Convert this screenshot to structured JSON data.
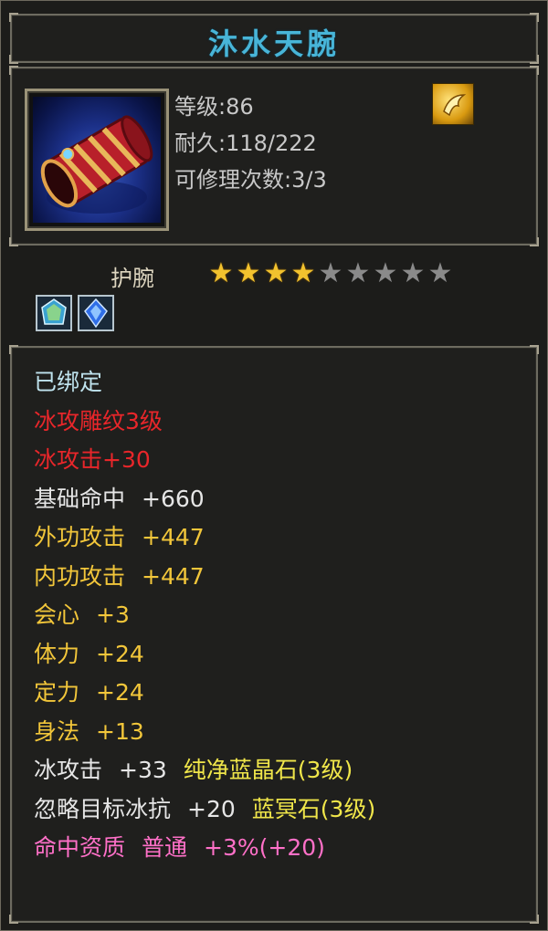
{
  "item_name": "沐水天腕",
  "level_label": "等级:86",
  "durability_label": "耐久:118/222",
  "repair_label": "可修理次数:3/3",
  "slot_type": "护腕",
  "stars": {
    "filled": 4,
    "total": 9
  },
  "gems": [
    "green-gem-icon",
    "blue-gem-icon"
  ],
  "attributes": [
    {
      "parts": [
        "已绑定"
      ],
      "color": "#bfe3ee"
    },
    {
      "parts": [
        "冰攻雕纹3级"
      ],
      "color": "#e8262a"
    },
    {
      "parts": [
        "冰攻击+30"
      ],
      "color": "#e8262a"
    },
    {
      "parts": [
        "基础命中",
        "+660"
      ],
      "color": "#e6e6e6"
    },
    {
      "parts": [
        "外功攻击",
        "+447"
      ],
      "color": "#f2c63a"
    },
    {
      "parts": [
        "内功攻击",
        "+447"
      ],
      "color": "#f2c63a"
    },
    {
      "parts": [
        "会心",
        "+3"
      ],
      "color": "#f2c63a"
    },
    {
      "parts": [
        "体力",
        "+24"
      ],
      "color": "#f2c63a"
    },
    {
      "parts": [
        "定力",
        "+24"
      ],
      "color": "#f2c63a"
    },
    {
      "parts": [
        "身法",
        "+13"
      ],
      "color": "#f2c63a"
    },
    {
      "parts": [
        "冰攻击",
        "+33",
        "纯净蓝晶石(3级)"
      ],
      "colors": [
        "#e6e6e6",
        "#e6e6e6",
        "#f0e64a"
      ]
    },
    {
      "parts": [
        "忽略目标冰抗",
        "+20",
        "蓝冥石(3级)"
      ],
      "colors": [
        "#e6e6e6",
        "#e6e6e6",
        "#f0e64a"
      ]
    },
    {
      "parts": [
        "命中资质",
        "普通",
        "+3%(+20)"
      ],
      "color": "#ff70c8"
    }
  ]
}
